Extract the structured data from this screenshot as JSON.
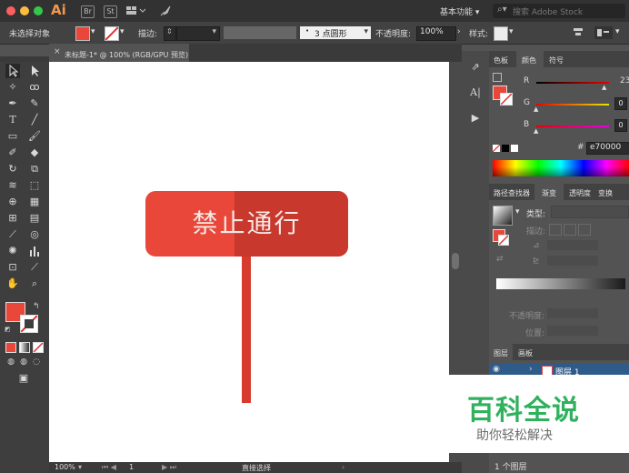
{
  "app": {
    "logo": "Ai",
    "icon_st": "St",
    "workspace": "基本功能",
    "search_placeholder": "搜索 Adobe Stock"
  },
  "controlbar": {
    "selection": "未选择对象",
    "stroke_label": "描边:",
    "brush": "3 点圆形",
    "opacity_label": "不透明度:",
    "opacity_value": "100%",
    "style_label": "样式:"
  },
  "document": {
    "tab": "未标题-1* @ 100% (RGB/GPU 预览)"
  },
  "artwork": {
    "sign_text": "禁止通行",
    "colors": {
      "sign_left": "#e8473a",
      "sign_right": "#c9382d",
      "pole": "#d63b2e"
    }
  },
  "color_panel": {
    "tabs": [
      "色板",
      "颜色",
      "符号"
    ],
    "channels": [
      {
        "name": "R",
        "value": "23"
      },
      {
        "name": "G",
        "value": "0"
      },
      {
        "name": "B",
        "value": "0"
      }
    ],
    "hex_label": "#",
    "hex_value": "e70000"
  },
  "gradient_panel": {
    "tabs": [
      "路径查找器",
      "渐变",
      "透明度",
      "变换"
    ],
    "type_label": "类型:",
    "stroke_label": "描边:",
    "opacity_label": "不透明度:",
    "position_label": "位置:"
  },
  "layers_panel": {
    "tabs": [
      "图层",
      "画板"
    ],
    "layer_name": "图层 1",
    "footer": "1 个图层"
  },
  "statusbar": {
    "zoom": "100%",
    "artboard": "1",
    "tool": "直接选择"
  },
  "watermark": {
    "title": "百科全说",
    "subtitle": "助你轻松解决"
  }
}
